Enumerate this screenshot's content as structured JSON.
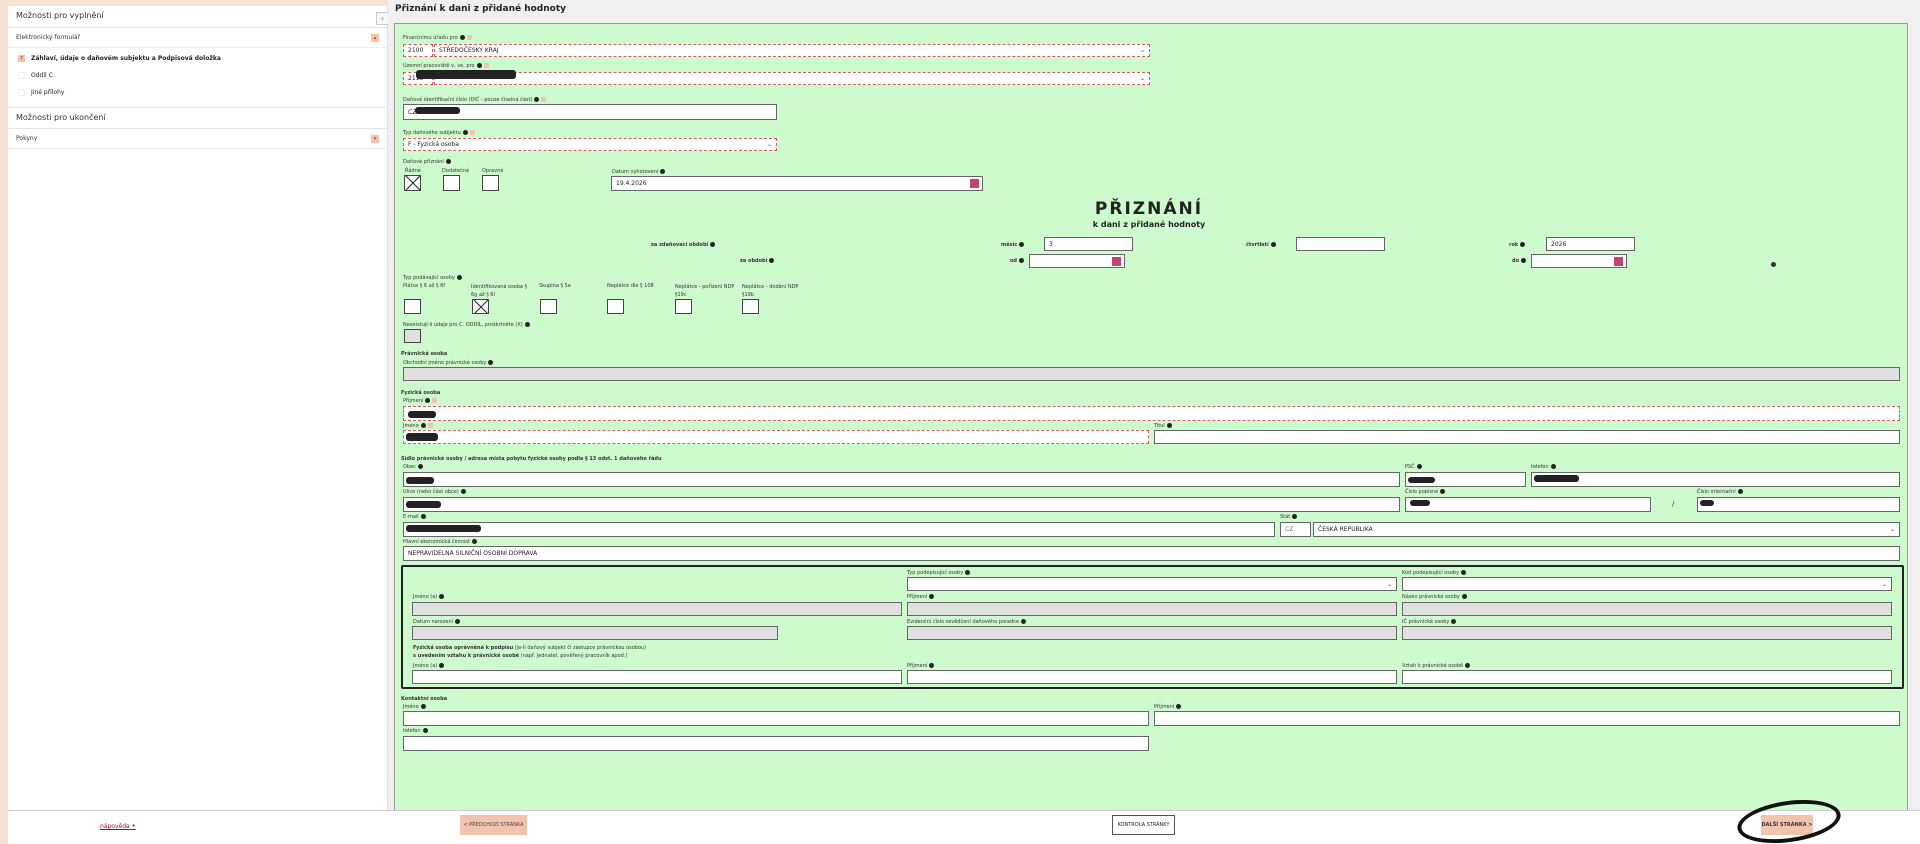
{
  "page_title": "Přiznání k dani z přidané hodnoty",
  "sidebar": {
    "fill_header": "Možnosti pro vyplnění",
    "eform_label": "Elektronický formulář",
    "items": [
      {
        "label": "Záhlaví, údaje o daňovém subjektu a Podpisová doložka",
        "active": true
      },
      {
        "label": "Oddíl C",
        "active": false
      },
      {
        "label": "Jiné přílohy",
        "active": false
      }
    ],
    "finish_header": "Možnosti pro ukončení",
    "instructions_label": "Pokyny",
    "collapse_glyph": "‹"
  },
  "form": {
    "office_label": "Finančnímu úřadu pro",
    "office_code": "2100",
    "office_value": "STŘEDOČESKÝ KRAJ",
    "workplace_label": "Územní pracoviště v, ve, pro",
    "workplace_code": "2113",
    "dic_label": "Daňové identifikační číslo (DIČ - pouze číselná část)",
    "dic_prefix": "CZ",
    "subject_type_label": "Typ daňového subjektu",
    "subject_type_value": "F - Fyzická osoba",
    "return_label": "Daňové přiznání",
    "return_options": [
      "Řádné",
      "Dodatečné",
      "Opravné"
    ],
    "date_label": "Datum vyhotovení",
    "date_value": "19.4.2026",
    "heading": "PŘIZNÁNÍ",
    "subheading": "k dani z přidané hodnoty",
    "period_label": "za zdaňovací období",
    "month_label": "měsíc",
    "month_value": "3",
    "quarter_label": "čtvrtletí",
    "year_label": "rok",
    "year_value": "2026",
    "over_period_label": "za období",
    "from_label": "od",
    "to_label": "do",
    "payer_type_label": "Typ podávající osoby",
    "payer_types": [
      "Plátce § 6 až § 6f",
      "Identifikovaná osoba § 6g až § 6l",
      "Skupina § 5a",
      "Neplátce dle § 108",
      "Neplátce - pořízení NDP §19c",
      "Neplátce - dodání NDP §19b"
    ],
    "no_data_label": "Neexistují-li údaje pro C. ODDÍL, proškrtněte (X)",
    "legal_header": "Právnická osoba",
    "business_name_label": "Obchodní jméno právnické osoby",
    "natural_header": "Fyzická osoba",
    "surname_label": "Příjmení",
    "firstname_label": "Jméno",
    "title_label": "Titul",
    "address_header": "Sídlo právnické osoby / adresa místa pobytu fyzické osoby podle § 13 odst. 1 daňového řádu",
    "municipality_label": "Obec",
    "zip_label": "PSČ",
    "phone_label": "telefon",
    "street_label": "Ulice (nebo část obce)",
    "house_no_label": "Číslo popisné",
    "orient_no_label": "Číslo orientační",
    "slash": "/",
    "email_label": "E-mail",
    "state_label": "Stát",
    "state_code": "CZ",
    "state_value": "ČESKÁ REPUBLIKA",
    "activity_label": "Hlavní ekonomická činnost",
    "activity_value": "NEPRAVIDELNÁ SILNIČNÍ OSOBNÍ DOPRAVA",
    "signatory": {
      "type_label": "Typ podepisující osoby",
      "code_label": "Kód podepisující osoby",
      "name_label": "Jméno (a)",
      "surname_label": "Příjmení",
      "entity_label": "Název právnické osoby",
      "birth_label": "Datum narození",
      "reg_label": "Evidenční číslo osvědčení daňového poradce",
      "ico_label": "IČ právnické osoby",
      "auth_line1_bold": "Fyzická osoba oprávněná k podpisu",
      "auth_line1_rest": " (je-li daňový subjekt či zástupce právnickou osobou)",
      "auth_line2_bold": "s uvedením vztahu k právnické osobě",
      "auth_line2_rest": " (např. jednatel, pověřený pracovník apod.)",
      "auth_name_label": "Jméno (a)",
      "auth_surname_label": "Příjmení",
      "relation_label": "Vztah k právnické osobě"
    },
    "contact_header": "Kontaktní osoba",
    "contact_name_label": "Jméno",
    "contact_surname_label": "Příjmení",
    "contact_phone_label": "telefon"
  },
  "footer": {
    "help": "nápověda",
    "prev": "< PŘEDCHOZÍ STRÁNKA",
    "check": "KONTROLA STRÁNKY",
    "next": "DALŠÍ STRÁNKA >"
  },
  "colors": {
    "form_bg": "#cdfbcd",
    "accent": "#f2c4b0",
    "page_bg": "#f6e2d0"
  }
}
